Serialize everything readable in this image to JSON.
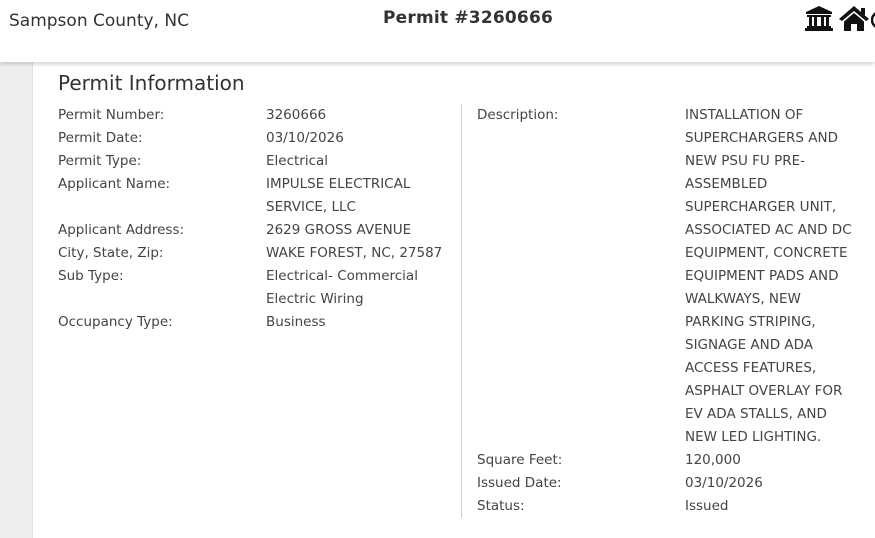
{
  "header": {
    "county": "Sampson County, NC",
    "title": "Permit #3260666",
    "icons": [
      "bank-icon",
      "home-icon"
    ]
  },
  "section": {
    "title": "Permit Information"
  },
  "left_fields": [
    {
      "label": "Permit Number:",
      "value": "3260666"
    },
    {
      "label": "Permit Date:",
      "value": "03/10/2026"
    },
    {
      "label": "Permit Type:",
      "value": "Electrical"
    },
    {
      "label": "Applicant Name:",
      "value": "IMPULSE ELECTRICAL SERVICE, LLC"
    },
    {
      "label": "Applicant Address:",
      "value": "2629 GROSS AVENUE"
    },
    {
      "label": "City, State, Zip:",
      "value": "WAKE FOREST, NC, 27587"
    },
    {
      "label": "Sub Type:",
      "value": "Electrical- Commercial Electric Wiring"
    },
    {
      "label": "Occupancy Type:",
      "value": "Business"
    }
  ],
  "right_fields": [
    {
      "label": "Description:",
      "value": "INSTALLATION OF SUPERCHARGERS AND NEW PSU FU PRE-ASSEMBLED SUPERCHARGER UNIT, ASSOCIATED AC AND DC EQUIPMENT, CONCRETE EQUIPMENT PADS AND WALKWAYS, NEW PARKING STRIPING, SIGNAGE AND ADA ACCESS FEATURES, ASPHALT OVERLAY FOR EV ADA STALLS, AND NEW LED LIGHTING."
    },
    {
      "label": "Square Feet:",
      "value": "120,000"
    },
    {
      "label": "Issued Date:",
      "value": "03/10/2026"
    },
    {
      "label": "Status:",
      "value": "Issued"
    }
  ],
  "colors": {
    "text": "#333333",
    "sidebar": "#eeeeee",
    "divider": "#cfcfcf"
  }
}
